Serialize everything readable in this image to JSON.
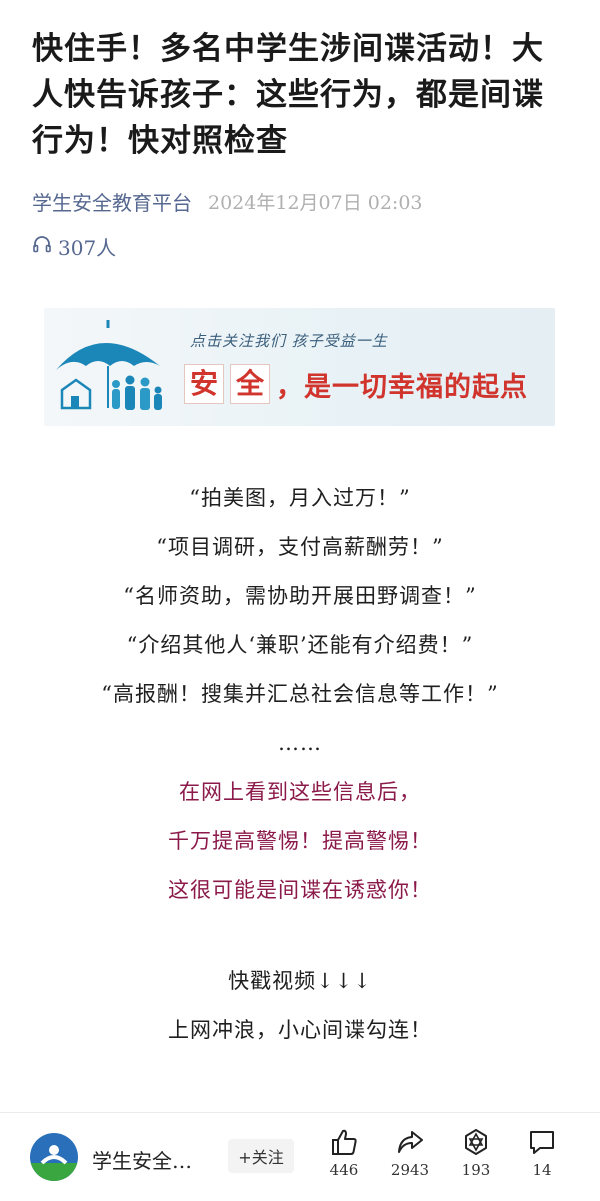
{
  "article": {
    "title": "快住手！多名中学生涉间谍活动！大人快告诉孩子：这些行为，都是间谍行为！快对照检查",
    "account": "学生安全教育平台",
    "datetime": "2024年12月07日  02:03",
    "listen_count": "307人"
  },
  "banner": {
    "tagline": "点击关注我们   孩子受益一生",
    "slogan_char": "安",
    "slogan_char2": "全",
    "slogan_rest": "，是一切幸福的起点"
  },
  "body_lines": [
    "“拍美图，月入过万！”",
    "“项目调研，支付高薪酬劳！”",
    "“名师资助，需协助开展田野调查！”",
    "“介绍其他人‘兼职’还能有介绍费！”",
    "“高报酬！搜集并汇总社会信息等工作！”",
    "……"
  ],
  "warning_lines": [
    "在网上看到这些信息后，",
    "千万提高警惕！提高警惕！",
    "这很可能是间谍在诱惑你！"
  ],
  "closing_lines": [
    "快戳视频↓↓↓",
    "上网冲浪，小心间谍勾连！"
  ],
  "bottom_bar": {
    "account_short": "学生安全…",
    "follow_label": "+关注",
    "like_count": "446",
    "share_count": "2943",
    "recommend_count": "193",
    "comment_count": "14"
  },
  "colors": {
    "account_link": "#566890",
    "warning_text": "#8b1a4a",
    "banner_red": "#d0342c"
  }
}
